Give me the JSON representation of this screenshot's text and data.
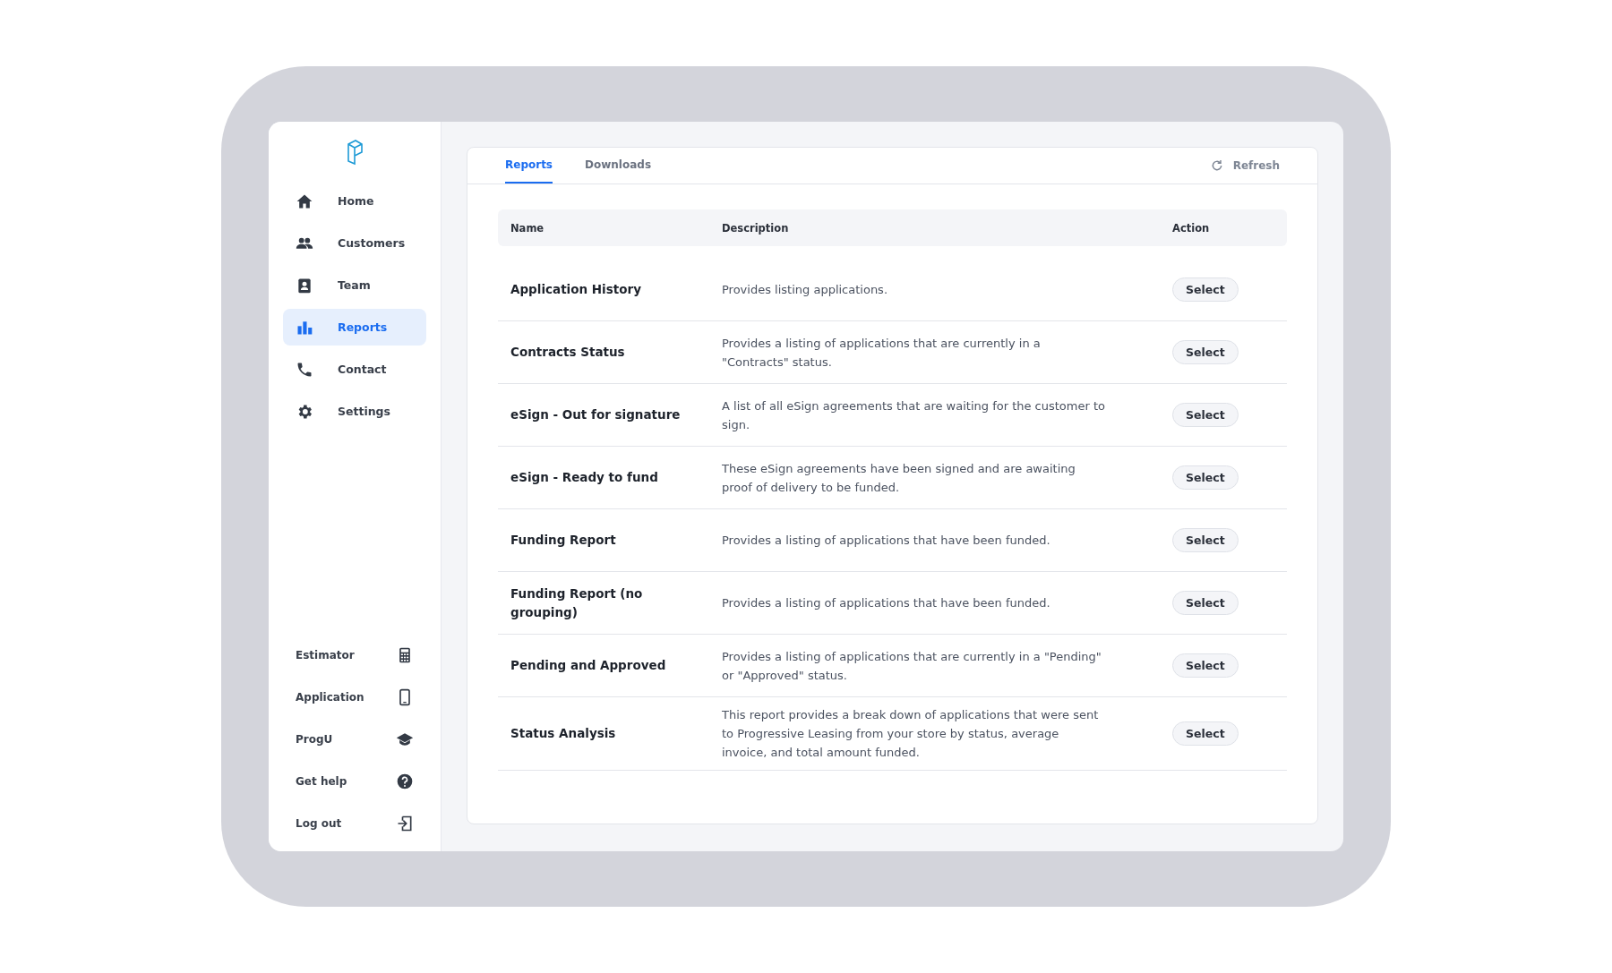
{
  "sidebar": {
    "nav": [
      {
        "label": "Home",
        "selected": false
      },
      {
        "label": "Customers",
        "selected": false
      },
      {
        "label": "Team",
        "selected": false
      },
      {
        "label": "Reports",
        "selected": true
      },
      {
        "label": "Contact",
        "selected": false
      },
      {
        "label": "Settings",
        "selected": false
      }
    ],
    "bottom_links": [
      {
        "label": "Estimator"
      },
      {
        "label": "Application"
      },
      {
        "label": "ProgU"
      },
      {
        "label": "Get help"
      },
      {
        "label": "Log out"
      }
    ]
  },
  "tabs": [
    {
      "label": "Reports",
      "selected": true
    },
    {
      "label": "Downloads",
      "selected": false
    }
  ],
  "refresh": "Refresh",
  "table": {
    "columns": [
      "Name",
      "Description",
      "Action"
    ],
    "rows": [
      {
        "name": "Application History",
        "description": "Provides listing applications.",
        "action": "Select"
      },
      {
        "name": "Contracts Status",
        "description": "Provides a listing of applications that are currently in a \"Contracts\" status.",
        "action": "Select"
      },
      {
        "name": "eSign - Out for signature",
        "description": "A list of all eSign agreements that are waiting for the customer to sign.",
        "action": "Select"
      },
      {
        "name": "eSign - Ready to fund",
        "description": "These eSign agreements have been signed and are awaiting proof of delivery to be funded.",
        "action": "Select"
      },
      {
        "name": "Funding Report",
        "description": "Provides a listing of applications that have been funded.",
        "action": "Select"
      },
      {
        "name": "Funding Report (no grouping)",
        "description": "Provides a listing of applications that have been funded.",
        "action": "Select"
      },
      {
        "name": "Pending and Approved",
        "description": "Provides a listing of applications that are currently in a \"Pending\" or \"Approved\" status.",
        "action": "Select"
      },
      {
        "name": "Status Analysis",
        "description": "This report provides a break down of applications that were sent to Progressive Leasing from your store by status, average invoice, and total amount funded.",
        "action": "Select"
      }
    ]
  }
}
